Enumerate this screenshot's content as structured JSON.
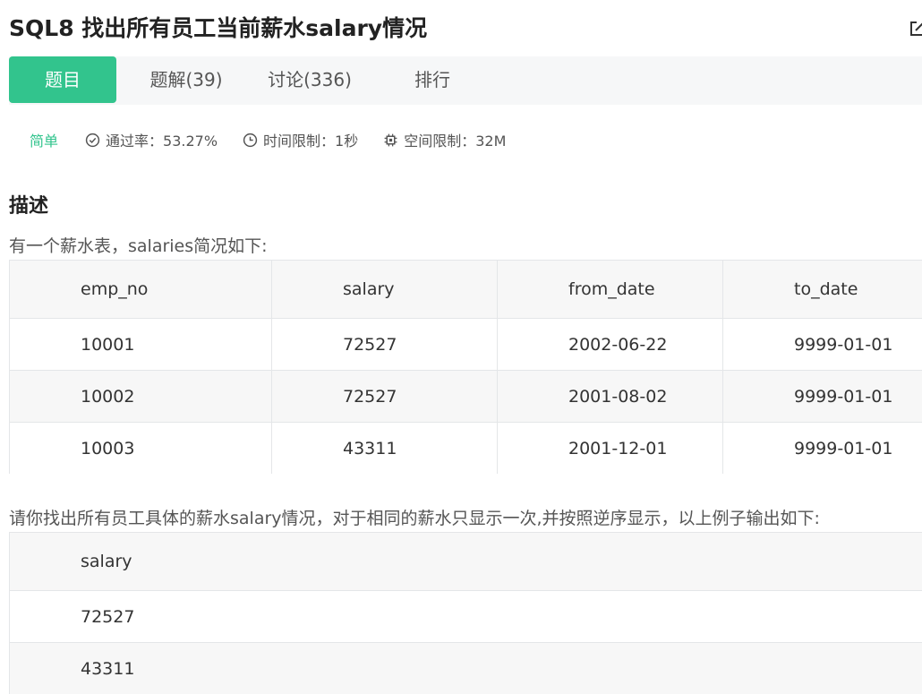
{
  "title": "SQL8  找出所有员工当前薪水salary情况",
  "tabs": [
    "题目",
    "题解(39)",
    "讨论(336)",
    "排行"
  ],
  "meta": {
    "difficulty": "简单",
    "pass_rate": "通过率：53.27%",
    "time_limit": "时间限制：1秒",
    "space_limit": "空间限制：32M"
  },
  "section_title": "描述",
  "intro": "有一个薪水表，salaries简况如下:",
  "salaries": {
    "headers": [
      "emp_no",
      "salary",
      "from_date",
      "to_date"
    ],
    "rows": [
      [
        "10001",
        "72527",
        "2002-06-22",
        "9999-01-01"
      ],
      [
        "10002",
        "72527",
        "2001-08-02",
        "9999-01-01"
      ],
      [
        "10003",
        "43311",
        "2001-12-01",
        "9999-01-01"
      ]
    ]
  },
  "question": "请你找出所有员工具体的薪水salary情况，对于相同的薪水只显示一次,并按照逆序显示，以上例子输出如下:",
  "output": {
    "headers": [
      "salary"
    ],
    "rows": [
      [
        "72527"
      ],
      [
        "43311"
      ]
    ]
  }
}
